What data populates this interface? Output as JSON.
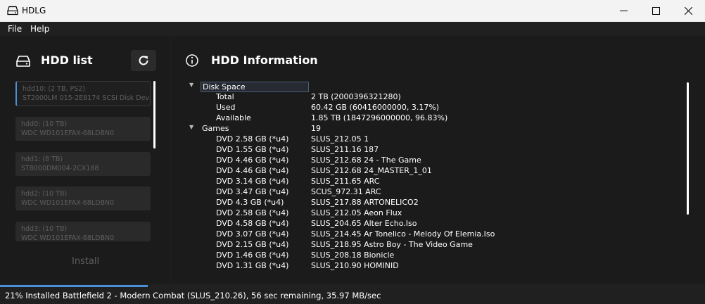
{
  "window": {
    "title": "HDLG"
  },
  "menu": {
    "file": "File",
    "help": "Help"
  },
  "left": {
    "title": "HDD list",
    "install_label": "Install",
    "drives": [
      {
        "line1": "hdd10: (2 TB, PS2)",
        "line2": "ST2000LM 015-2E8174 SCSI Disk Devi"
      },
      {
        "line1": "hdd0: (10 TB)",
        "line2": "WDC WD101EFAX-68LDBN0"
      },
      {
        "line1": "hdd1: (8 TB)",
        "line2": "ST8000DM004-2CX188"
      },
      {
        "line1": "hdd2: (10 TB)",
        "line2": "WDC WD101EFAX-68LDBN0"
      },
      {
        "line1": "hdd3: (10 TB)",
        "line2": "WDC WD101EFAX-68LDBN0"
      }
    ]
  },
  "info": {
    "title": "HDD Information",
    "disk_space": {
      "label": "Disk Space",
      "total_label": "Total",
      "total": "2 TB (2000396321280)",
      "used_label": "Used",
      "used": "60.42 GB (60416000000, 3.17%)",
      "available_label": "Available",
      "available": "1.85 TB (1847296000000, 96.83%)"
    },
    "games": {
      "label": "Games",
      "count": "19",
      "items": [
        {
          "k": "DVD 2.58 GB (*u4)",
          "v": "SLUS_212.05 1"
        },
        {
          "k": "DVD 1.55 GB (*u4)",
          "v": "SLUS_211.16 187"
        },
        {
          "k": "DVD 4.46 GB (*u4)",
          "v": "SLUS_212.68 24 - The Game"
        },
        {
          "k": "DVD 4.46 GB (*u4)",
          "v": "SLUS_212.68 24_MASTER_1_01"
        },
        {
          "k": "DVD 3.14 GB (*u4)",
          "v": "SLUS_211.65 ARC"
        },
        {
          "k": "DVD 3.47 GB (*u4)",
          "v": "SCUS_972.31 ARC"
        },
        {
          "k": "DVD 4.3 GB (*u4)",
          "v": "SLUS_217.88 ARTONELICO2"
        },
        {
          "k": "DVD 2.58 GB (*u4)",
          "v": "SLUS_212.05 Aeon Flux"
        },
        {
          "k": "DVD 4.58 GB (*u4)",
          "v": "SLUS_204.65 Alter Echo.Iso"
        },
        {
          "k": "DVD 3.07 GB (*u4)",
          "v": "SLUS_214.45 Ar Tonelico - Melody Of Elemia.Iso"
        },
        {
          "k": "DVD 2.15 GB (*u4)",
          "v": "SLUS_218.95 Astro Boy - The Video Game"
        },
        {
          "k": "DVD 1.46 GB (*u4)",
          "v": "SLUS_208.18 Bionicle"
        },
        {
          "k": "DVD 1.31 GB (*u4)",
          "v": "SLUS_210.90 HOMINID"
        }
      ]
    }
  },
  "status": {
    "text": "21% Installed Battlefield 2 - Modern Combat  (SLUS_210.26), 56 sec remaining, 35.97 MB/sec",
    "progress_fraction": 0.21
  },
  "colors": {
    "accent": "#4a90d9",
    "panel": "#1b1b1b",
    "bg": "#202020"
  }
}
